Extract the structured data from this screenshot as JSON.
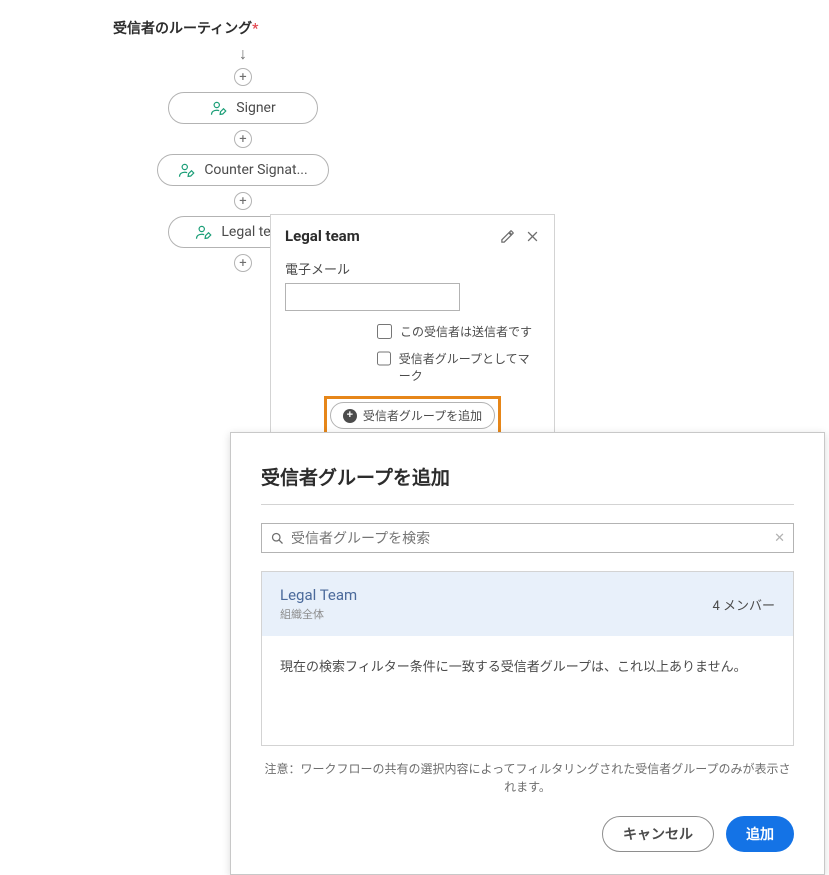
{
  "routing": {
    "title": "受信者のルーティング",
    "nodes": [
      {
        "label": "Signer"
      },
      {
        "label": "Counter Signat..."
      },
      {
        "label": "Legal team"
      }
    ]
  },
  "panel": {
    "title": "Legal team",
    "field_label": "電子メール",
    "email_value": "",
    "checkbox_sender": "この受信者は送信者です",
    "checkbox_mark_group": "受信者グループとしてマーク",
    "add_group_label": "受信者グループを追加"
  },
  "modal": {
    "title": "受信者グループを追加",
    "search_placeholder": "受信者グループを検索",
    "search_value": "",
    "result": {
      "name": "Legal Team",
      "scope": "組織全体",
      "members": "4 メンバー"
    },
    "empty_message": "現在の検索フィルター条件に一致する受信者グループは、これ以上ありません。",
    "note": "注意：ワークフローの共有の選択内容によってフィルタリングされた受信者グループのみが表示されます。",
    "cancel_label": "キャンセル",
    "submit_label": "追加"
  }
}
